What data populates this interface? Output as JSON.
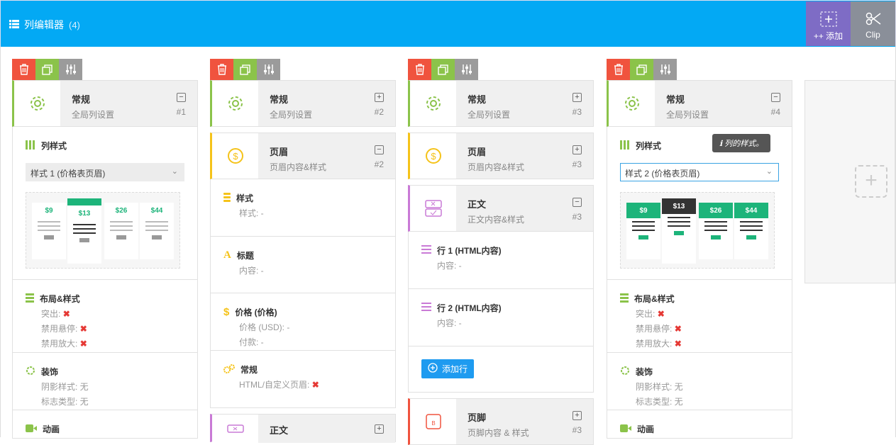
{
  "header": {
    "title": "列编辑器",
    "count": "(4)",
    "add_label": "++ 添加",
    "clip_label": "Clip"
  },
  "colors": {
    "accent": "#03a9f4",
    "delete": "#f0533e",
    "copy": "#8bc34a",
    "settings": "#9b9b9b",
    "add": "#7e6cc5",
    "clip": "#8a8f99"
  },
  "columns": [
    {
      "general": {
        "title": "常规",
        "subtitle": "全局列设置",
        "num": "#1",
        "toggle": "−"
      },
      "style": {
        "title": "列样式",
        "select": "样式 1 (价格表页眉)",
        "prices": [
          "$9",
          "$13",
          "$26",
          "$44"
        ]
      },
      "layout": {
        "title": "布局&样式",
        "l1": "突出:",
        "l2": "禁用悬停:",
        "l3": "禁用放大:"
      },
      "decor": {
        "title": "装饰",
        "l1": "阴影样式: 无",
        "l2": "标志类型: 无"
      },
      "anim": {
        "title": "动画"
      }
    },
    {
      "general": {
        "title": "常规",
        "subtitle": "全局列设置",
        "num": "#2",
        "toggle": "+"
      },
      "header": {
        "title": "页眉",
        "subtitle": "页眉内容&样式",
        "num": "#2",
        "toggle": "−"
      },
      "items": [
        {
          "title": "样式",
          "line": "样式: -"
        },
        {
          "title": "标题",
          "line": "内容: -"
        },
        {
          "title": "价格 (价格)",
          "line": "价格 (USD): -",
          "line2": "付款: -"
        },
        {
          "title": "常规",
          "line": "HTML/自定义页眉:"
        }
      ],
      "body": {
        "title": "正文",
        "toggle": "+"
      }
    },
    {
      "general": {
        "title": "常规",
        "subtitle": "全局列设置",
        "num": "#3",
        "toggle": "+"
      },
      "header": {
        "title": "页眉",
        "subtitle": "页眉内容&样式",
        "num": "#3",
        "toggle": "+"
      },
      "body": {
        "title": "正文",
        "subtitle": "正文内容&样式",
        "num": "#3",
        "toggle": "−"
      },
      "rows": [
        {
          "title": "行 1 (HTML内容)",
          "line": "内容: -"
        },
        {
          "title": "行 2 (HTML内容)",
          "line": "内容: -"
        }
      ],
      "add_row": "添加行",
      "footer": {
        "title": "页脚",
        "subtitle": "页脚内容 & 样式",
        "num": "#3",
        "toggle": "+"
      }
    },
    {
      "general": {
        "title": "常规",
        "subtitle": "全局列设置",
        "num": "#4",
        "toggle": "−"
      },
      "style": {
        "title": "列样式",
        "select": "样式 2 (价格表页眉)",
        "tooltip": "列的样式。",
        "prices": [
          "$9",
          "$13",
          "$26",
          "$44"
        ]
      },
      "layout": {
        "title": "布局&样式",
        "l1": "突出:",
        "l2": "禁用悬停:",
        "l3": "禁用放大:"
      },
      "decor": {
        "title": "装饰",
        "l1": "阴影样式: 无",
        "l2": "标志类型: 无"
      },
      "anim": {
        "title": "动画"
      }
    }
  ]
}
